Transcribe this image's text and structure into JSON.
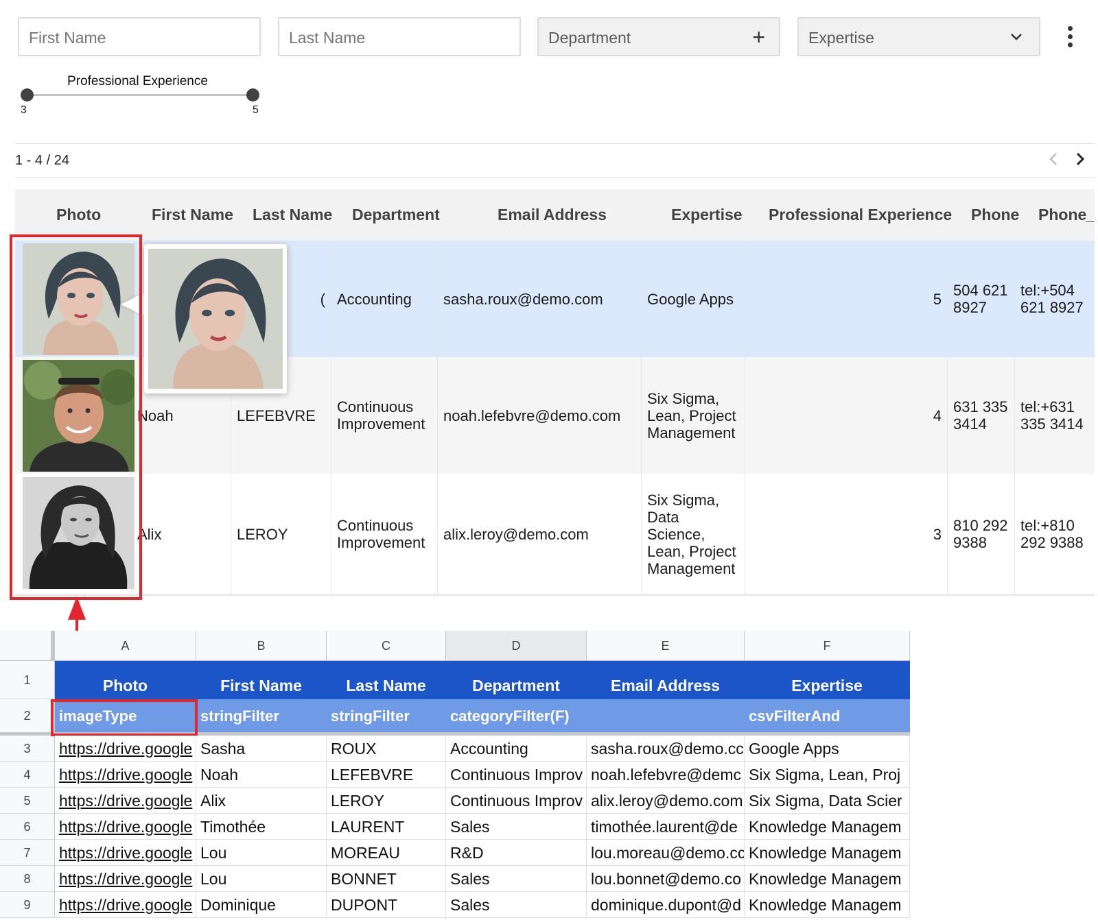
{
  "filters": {
    "first_name_placeholder": "First Name",
    "last_name_placeholder": "Last Name",
    "department_label": "Department",
    "department_icon": "plus-icon",
    "expertise_label": "Expertise",
    "expertise_icon": "chevron-down-icon",
    "menu_icon": "more-vertical-icon"
  },
  "slider": {
    "label": "Professional Experience",
    "min_value": "3",
    "max_value": "5",
    "knob_color": "#424242"
  },
  "pager": {
    "count": "1 - 4 / 24",
    "prev_icon": "chevron-left-icon",
    "next_icon": "chevron-right-icon"
  },
  "card_table": {
    "headers": [
      "Photo",
      "First Name",
      "Last Name",
      "Department",
      "Email Address",
      "Expertise",
      "Professional Experience",
      "Phone",
      "Phone_"
    ],
    "rows": [
      {
        "first_name": "",
        "last_name": "(",
        "department": "Accounting",
        "email": "sasha.roux@demo.com",
        "expertise": "Google Apps",
        "experience": "5",
        "phone": "504 621 8927",
        "phone_link": "tel:+504 621 8927"
      },
      {
        "first_name": "Noah",
        "last_name": "LEFEBVRE",
        "department": "Continuous Improvement",
        "email": "noah.lefebvre@demo.com",
        "expertise": "Six Sigma, Lean, Project Management",
        "experience": "4",
        "phone": "631 335 3414",
        "phone_link": "tel:+631 335 3414"
      },
      {
        "first_name": "Alix",
        "last_name": "LEROY",
        "department": "Continuous Improvement",
        "email": "alix.leroy@demo.com",
        "expertise": "Six Sigma, Data Science, Lean, Project Management",
        "experience": "3",
        "phone": "810 292 9388",
        "phone_link": "tel:+810 292 9388"
      }
    ],
    "selected_row_color": "#dce8fb",
    "alt_row_color": "#f5f5f5"
  },
  "sheet": {
    "columns": [
      "A",
      "B",
      "C",
      "D",
      "E",
      "F"
    ],
    "header_row": [
      "Photo",
      "First Name",
      "Last Name",
      "Department",
      "Email Address",
      "Expertise"
    ],
    "type_row": [
      "imageType",
      "stringFilter",
      "stringFilter",
      "categoryFilter(F)",
      "",
      "csvFilterAnd"
    ],
    "row_numbers": [
      "1",
      "2",
      "3",
      "4",
      "5",
      "6",
      "7",
      "8",
      "9"
    ],
    "rows": [
      [
        "https://drive.google",
        "Sasha",
        "ROUX",
        "Accounting",
        "sasha.roux@demo.cc",
        "Google Apps"
      ],
      [
        "https://drive.google",
        "Noah",
        "LEFEBVRE",
        "Continuous Improv",
        "noah.lefebvre@demc",
        "Six Sigma, Lean, Proj"
      ],
      [
        "https://drive.google",
        "Alix",
        "LEROY",
        "Continuous Improv",
        "alix.leroy@demo.com",
        "Six Sigma, Data Scier"
      ],
      [
        "https://drive.google",
        "Timothée",
        "LAURENT",
        "Sales",
        "timothée.laurent@de",
        "Knowledge Managem"
      ],
      [
        "https://drive.google",
        "Lou",
        "MOREAU",
        "R&D",
        "lou.moreau@demo.cc",
        "Knowledge Managem"
      ],
      [
        "https://drive.google",
        "Lou",
        "BONNET",
        "Sales",
        "lou.bonnet@demo.co",
        "Knowledge Managem"
      ],
      [
        "https://drive.google",
        "Dominique",
        "DUPONT",
        "Sales",
        "dominique.dupont@d",
        "Knowledge Managem"
      ]
    ],
    "header_color": "#1c55c7",
    "type_row_color": "#6e9ae6"
  },
  "annotation": {
    "color": "#e3262b"
  }
}
